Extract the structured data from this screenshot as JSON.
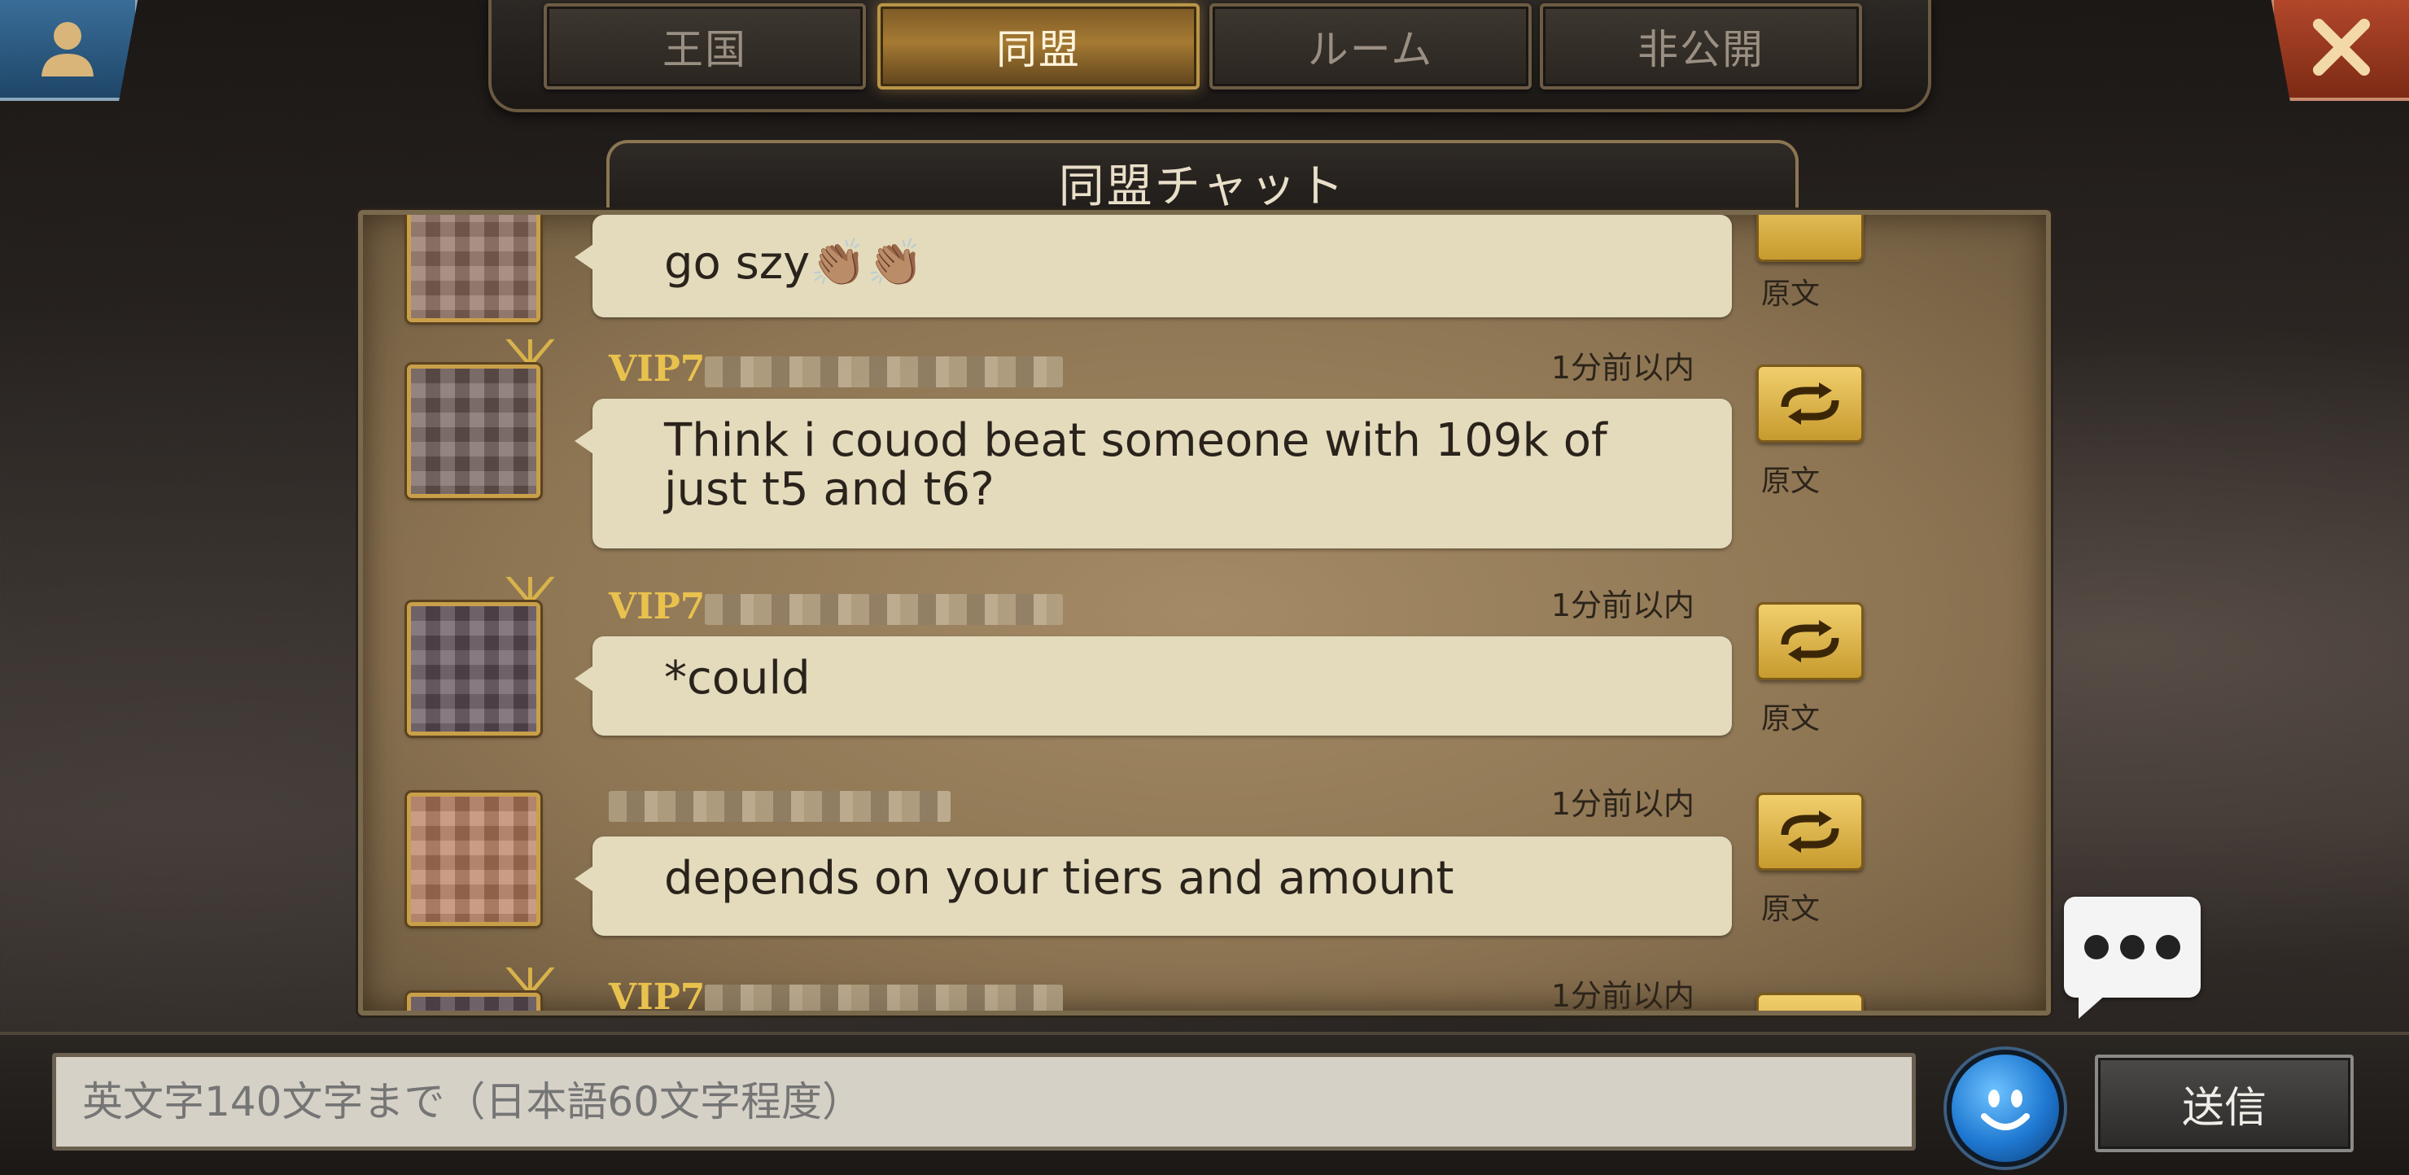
{
  "tabs": [
    {
      "label": "王国",
      "active": false
    },
    {
      "label": "同盟",
      "active": true
    },
    {
      "label": "ルーム",
      "active": false
    },
    {
      "label": "非公開",
      "active": false
    }
  ],
  "panel": {
    "title": "同盟チャット"
  },
  "messages": [
    {
      "text": "go szy👏🏽👏🏽",
      "translate_label": "原文"
    },
    {
      "vip": "VIP7",
      "time": "1分前以内",
      "text": "Think i couod beat someone with 109k of just t5 and t6?",
      "translate_label": "原文"
    },
    {
      "vip": "VIP7",
      "time": "1分前以内",
      "text": "*could",
      "translate_label": "原文"
    },
    {
      "time": "1分前以内",
      "text": "depends on your tiers and amount",
      "translate_label": "原文"
    },
    {
      "vip": "VIP7",
      "time": "1分前以内"
    }
  ],
  "input": {
    "placeholder": "英文字140文字まで（日本語60文字程度）"
  },
  "send_label": "送信",
  "colors": {
    "accent_gold": "#e9c24e",
    "close_red": "#b4482b",
    "profile_blue": "#3a6f9a"
  }
}
